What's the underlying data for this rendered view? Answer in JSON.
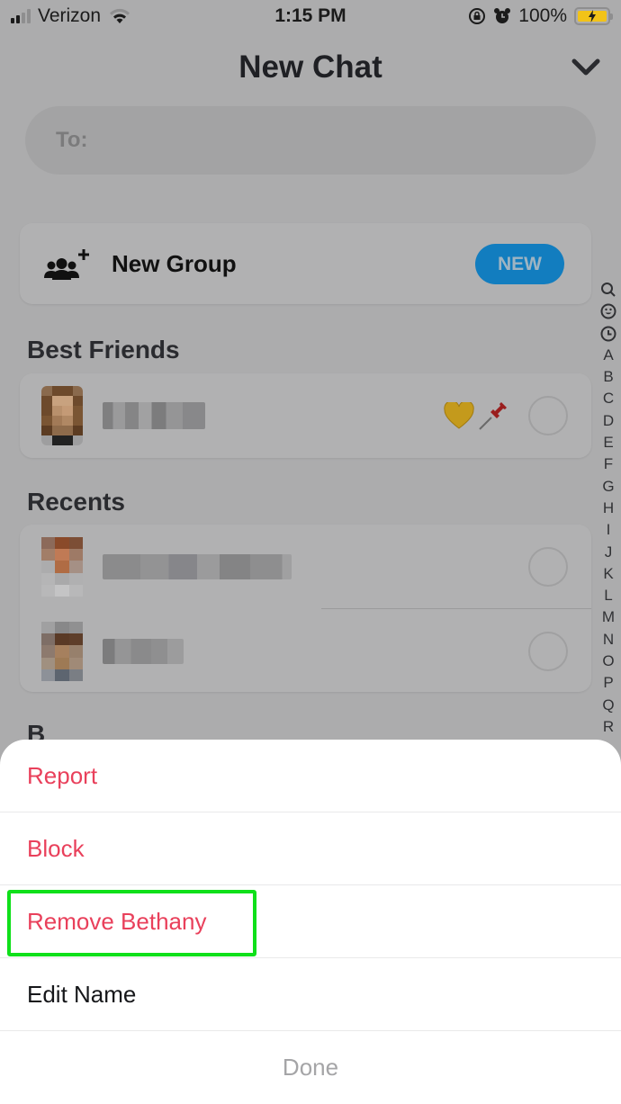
{
  "status_bar": {
    "carrier": "Verizon",
    "time": "1:15 PM",
    "battery_percent": "100%",
    "signal_bars_active": 2,
    "signal_bars_total": 4,
    "battery_charging": true
  },
  "header": {
    "title": "New Chat",
    "collapse_icon": "chevron-down-icon"
  },
  "to_field": {
    "label": "To:",
    "value": ""
  },
  "new_group": {
    "label": "New Group",
    "icon": "add-group-icon",
    "badge": "NEW"
  },
  "sections": {
    "best_friends": {
      "title": "Best Friends",
      "rows": [
        {
          "name": "Bethany",
          "name_obscured": true,
          "emojis": [
            "💛",
            "📌"
          ],
          "selected": false
        }
      ]
    },
    "recents": {
      "title": "Recents",
      "rows": [
        {
          "name": "",
          "name_obscured": true,
          "selected": false
        },
        {
          "name": "",
          "name_obscured": true,
          "selected": false
        }
      ]
    },
    "next_letter": "B"
  },
  "alpha_index": [
    "search",
    "emoji",
    "recent",
    "A",
    "B",
    "C",
    "D",
    "E",
    "F",
    "G",
    "H",
    "I",
    "J",
    "K",
    "L",
    "M",
    "N",
    "O",
    "P",
    "Q",
    "R"
  ],
  "action_sheet": {
    "items": [
      {
        "label": "Report",
        "style": "destructive"
      },
      {
        "label": "Block",
        "style": "destructive"
      },
      {
        "label": "Remove Bethany",
        "style": "destructive",
        "highlighted": true
      },
      {
        "label": "Edit Name",
        "style": "normal"
      }
    ],
    "done_label": "Done"
  },
  "colors": {
    "destructive": "#e9405b",
    "badge_blue": "#127dbf",
    "highlight_green": "#0fe01a",
    "dim_overlay": "#acacad"
  }
}
